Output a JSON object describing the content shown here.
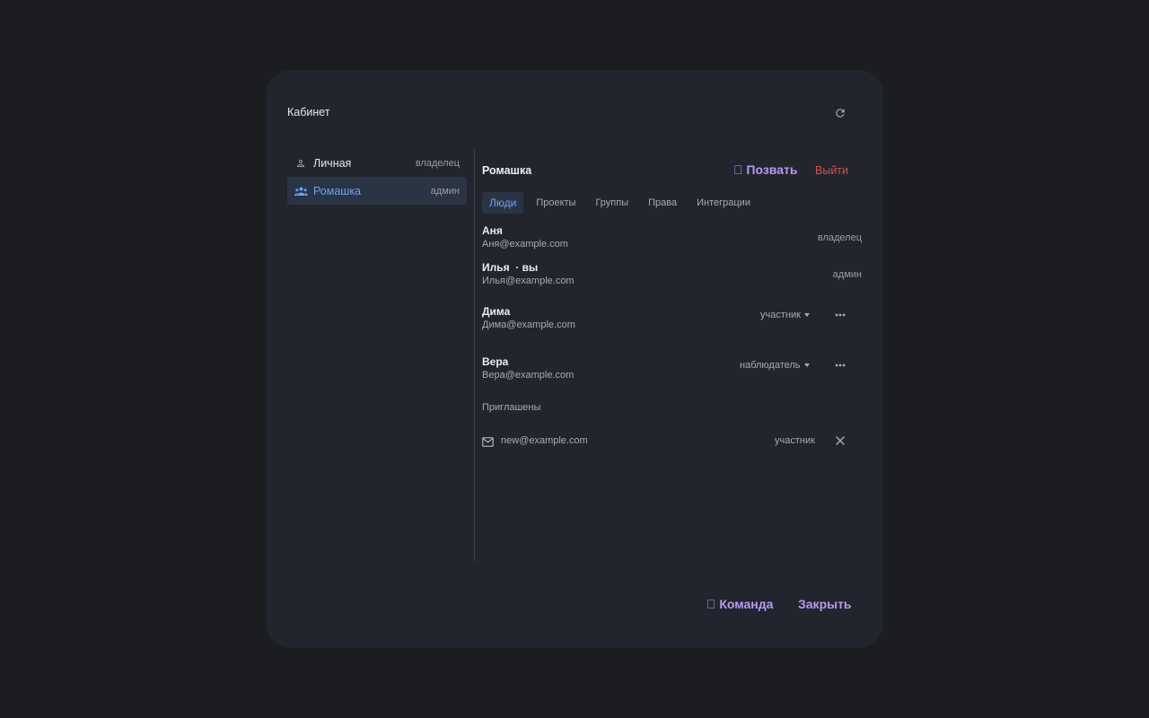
{
  "dialog": {
    "title": "Кабинет"
  },
  "sidebar": {
    "items": [
      {
        "label": "Личная",
        "role": "владелец",
        "icon": "person-icon"
      },
      {
        "label": "Ромашка",
        "role": "админ",
        "icon": "group-icon",
        "active": true
      }
    ]
  },
  "team": {
    "name": "Ромашка",
    "invite_label": "󰀒 Позвать",
    "leave_label": "Выйти"
  },
  "tabs": [
    "Люди",
    "Проекты",
    "Группы",
    "Права",
    "Интеграции"
  ],
  "members": [
    {
      "name": "Аня",
      "email": "Аня@example.com",
      "role": "владелец"
    },
    {
      "name": "Илья  · вы",
      "email": "Илья@example.com",
      "role": "админ"
    },
    {
      "name": "Дима",
      "email": "Дима@example.com",
      "role": "участник"
    },
    {
      "name": "Вера",
      "email": "Вера@example.com",
      "role": "наблюдатель"
    }
  ],
  "invited": {
    "label": "Приглашены",
    "items": [
      {
        "email": "new@example.com",
        "role": "участник"
      }
    ]
  },
  "footer": {
    "team_label": "󰀒 Команда",
    "close_label": "Закрыть"
  },
  "colors": {
    "accent": "#b99af0",
    "active_blue": "#6aa2f0",
    "danger": "#e04b4b"
  }
}
